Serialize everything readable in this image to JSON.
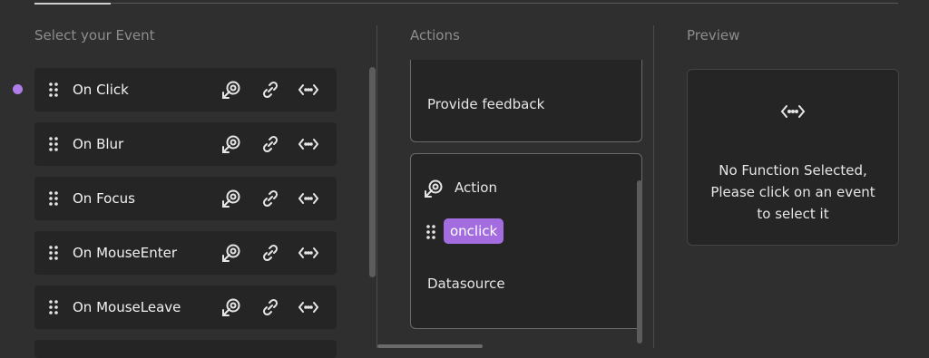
{
  "columns": {
    "events_title": "Select your Event",
    "actions_title": "Actions",
    "preview_title": "Preview"
  },
  "events": [
    {
      "label": "On Click",
      "selected": true
    },
    {
      "label": "On Blur"
    },
    {
      "label": "On Focus"
    },
    {
      "label": "On MouseEnter"
    },
    {
      "label": "On MouseLeave"
    }
  ],
  "event_icons": [
    "action-pointer-icon",
    "link-icon",
    "code-icon"
  ],
  "actions": {
    "card1_text": "Provide feedback",
    "card2_title": "Action",
    "card2_pill": "onclick",
    "card2_footer": "Datasource"
  },
  "preview": {
    "message": "No Function Selected,\nPlease click on an event\nto select it"
  },
  "colors": {
    "accent": "#a36de0",
    "selected_dot": "#b07ce8",
    "background": "#2f2f2f",
    "card": "#252525"
  }
}
